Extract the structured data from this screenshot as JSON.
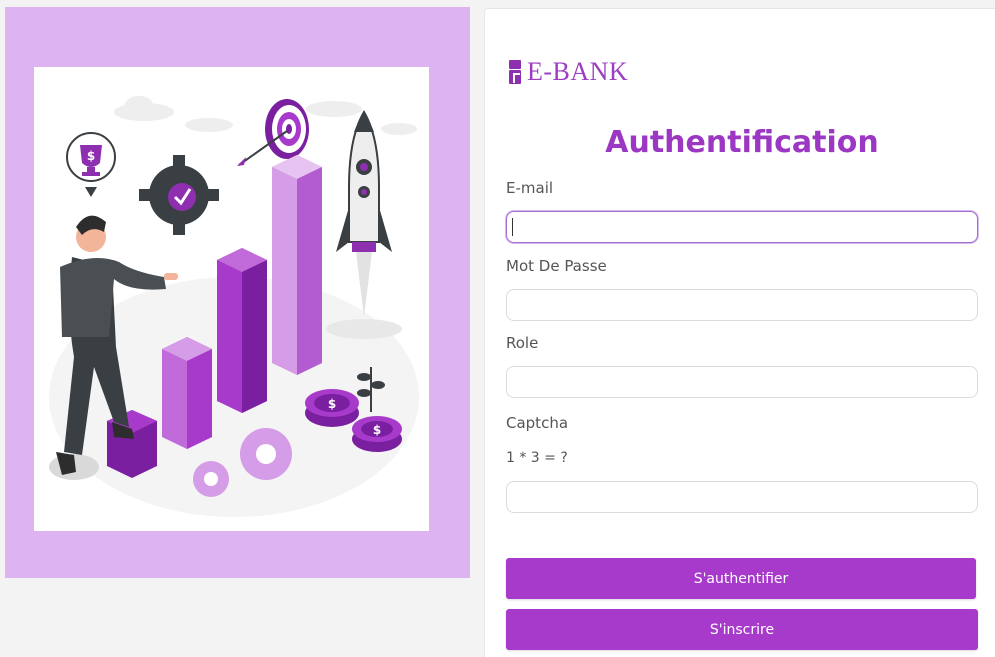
{
  "brand": {
    "name": "E-BANK",
    "icon": "bank-logo-icon",
    "color": "#9b3fc0"
  },
  "illustration": {
    "icon": "business-growth-illustration"
  },
  "form": {
    "title": "Authentification",
    "email": {
      "label": "E-mail",
      "value": ""
    },
    "password": {
      "label": "Mot De Passe",
      "value": ""
    },
    "role": {
      "label": "Role",
      "value": ""
    },
    "captcha": {
      "label": "Captcha",
      "question": "1 * 3 = ?",
      "value": ""
    },
    "login_label": "S'authentifier",
    "register_label": "S'inscrire"
  },
  "colors": {
    "accent": "#a83acb",
    "title": "#9b37c2",
    "panel_bg": "#ddb3f2"
  }
}
